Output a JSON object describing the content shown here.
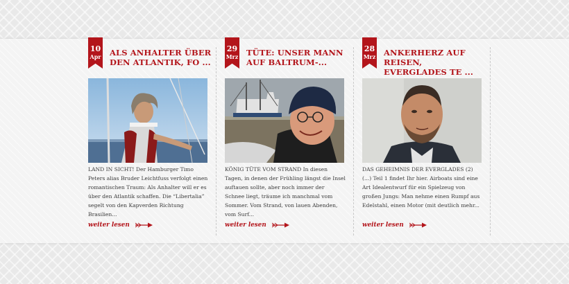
{
  "posts": [
    {
      "day": "10",
      "month": "Apr",
      "title": "ALS ANHALTER ÜBER DEN ATLANTIK, FO ...",
      "image_alt": "Mann auf Segelboot",
      "excerpt": "LAND IN SICHT! Der Hamburger Timo Peters alias Bruder Leichtfuss verfolgt einen romantischen Traum: Als Anhalter will er es über den Atlantik schaffen. Die “Libertalia” segelt von den Kapverden Richtung Brasilien...",
      "readmore": "weiter lesen"
    },
    {
      "day": "29",
      "month": "Mrz",
      "title": "TÜTE: UNSER MANN AUF BALTRUM-...",
      "image_alt": "Mann mit Mütze vor Fischkutter",
      "excerpt": "KÖNIG TÜTE VOM STRAND    In diesen Tagen, in denen der Frühling längst die Insel auftauen sollte, aber noch immer der Schnee liegt, träume ich manchmal vom Sommer. Vom Strand, von lauen Abenden, vom Surf...",
      "readmore": "weiter lesen"
    },
    {
      "day": "28",
      "month": "Mrz",
      "title": "ANKERHERZ AUF REISEN, EVERGLADES TE ...",
      "image_alt": "Portrait eines Mannes",
      "excerpt": "DAS GEHEIMNIS DER EVERGLADES (2)  (...) Teil 1 findet Ihr hier.    Airboats sind eine Art Idealentwurf für ein Spielzeug von großen Jungs: Man nehme einen Rumpf aus Edelstahl, einen Motor (mit deutlich mehr...",
      "readmore": "weiter lesen"
    }
  ],
  "icons": {
    "readmore": "arrow-right-icon"
  },
  "colors": {
    "accent": "#b3151b",
    "text": "#3a3a3a",
    "band": "#f4f4f4"
  }
}
